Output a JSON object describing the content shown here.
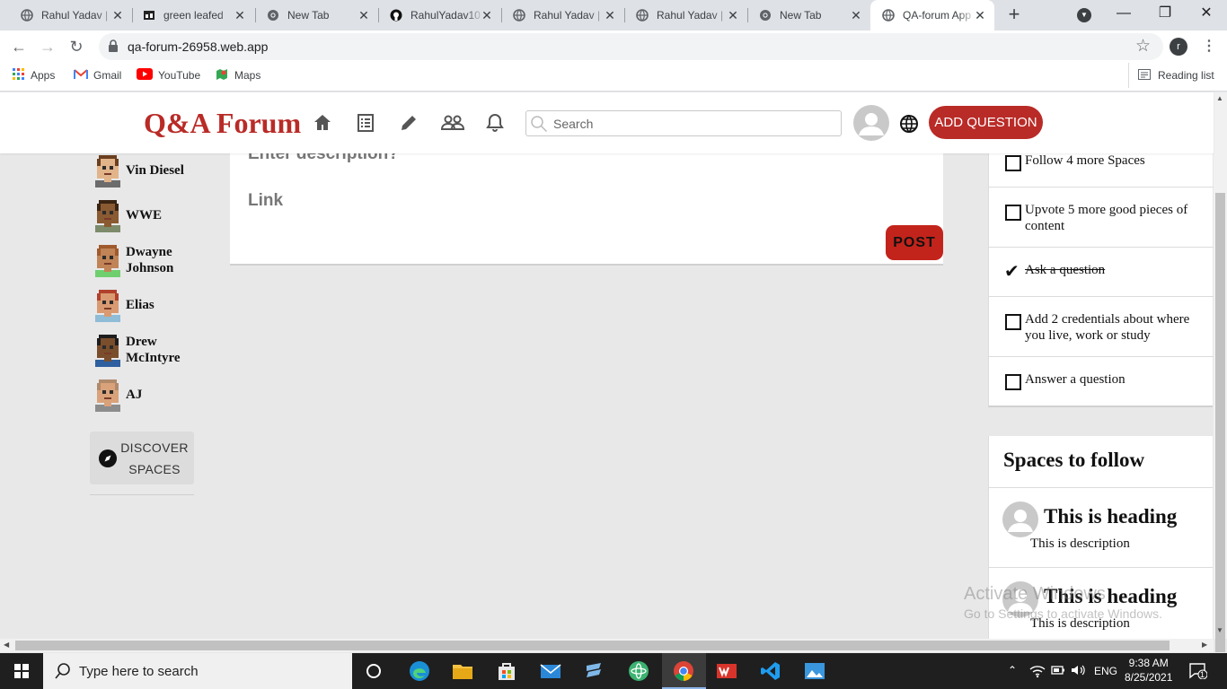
{
  "browser": {
    "tabs": [
      {
        "title": "Rahul Yadav | ",
        "icon": "globe-icon"
      },
      {
        "title": "green leafed",
        "icon": "image-icon"
      },
      {
        "title": "New Tab",
        "icon": "chrome-icon"
      },
      {
        "title": "RahulYadav10",
        "icon": "github-icon"
      },
      {
        "title": "Rahul Yadav | ",
        "icon": "globe-icon"
      },
      {
        "title": "Rahul Yadav | ",
        "icon": "globe-icon"
      },
      {
        "title": "New Tab",
        "icon": "chrome-icon"
      },
      {
        "title": "QA-forum App",
        "icon": "globe-icon"
      }
    ],
    "url": "qa-forum-26958.web.app",
    "profile_initial": "r",
    "bookmarks": [
      "Apps",
      "Gmail",
      "YouTube",
      "Maps"
    ],
    "reading_list": "Reading list"
  },
  "header": {
    "logo": "Q&A Forum",
    "search_placeholder": "Search",
    "add_question": "ADD QUESTION"
  },
  "sidebar": {
    "spaces": [
      {
        "name": "Vin Diesel",
        "skin": "#e2b48a",
        "hair": "#6b3f1f",
        "shirt": "#6c6c6c"
      },
      {
        "name": "WWE",
        "skin": "#8a5a32",
        "hair": "#3a2412",
        "shirt": "#7d8b6a"
      },
      {
        "name": "Dwayne Johnson",
        "skin": "#c08456",
        "hair": "#a05a2c",
        "shirt": "#6fcf6f"
      },
      {
        "name": "Elias",
        "skin": "#d99a72",
        "hair": "#b0412c",
        "shirt": "#8fbcd6"
      },
      {
        "name": "Drew McIntyre",
        "skin": "#7a4e2c",
        "hair": "#1d1d1d",
        "shirt": "#2f5f9e"
      },
      {
        "name": "AJ",
        "skin": "#d9a27a",
        "hair": "#b08a6a",
        "shirt": "#8c8c8c"
      }
    ],
    "discover": "DISCOVER SPACES"
  },
  "form": {
    "description_placeholder": "Enter description?",
    "link_placeholder": "Link",
    "post": "POST"
  },
  "checklist": [
    {
      "text": "Follow 4 more Spaces",
      "done": false
    },
    {
      "text": "Upvote 5 more good pieces of content",
      "done": false
    },
    {
      "text": "Ask a question",
      "done": true
    },
    {
      "text": "Add 2 credentials about where you live, work or study",
      "done": false
    },
    {
      "text": "Answer a question",
      "done": false
    }
  ],
  "spaces_to_follow": {
    "title": "Spaces to follow",
    "items": [
      {
        "heading": "This is heading",
        "description": "This is description"
      },
      {
        "heading": "This is heading",
        "description": "This is description"
      }
    ]
  },
  "watermark": {
    "line1": "Activate Windows",
    "line2": "Go to Settings to activate Windows."
  },
  "taskbar": {
    "search_placeholder": "Type here to search",
    "language": "ENG",
    "time": "9:38 AM",
    "date": "8/25/2021",
    "notifications": "1"
  },
  "colors": {
    "brand": "#b92b27",
    "post": "#c2241b",
    "page_bg": "#e8e8e9"
  }
}
